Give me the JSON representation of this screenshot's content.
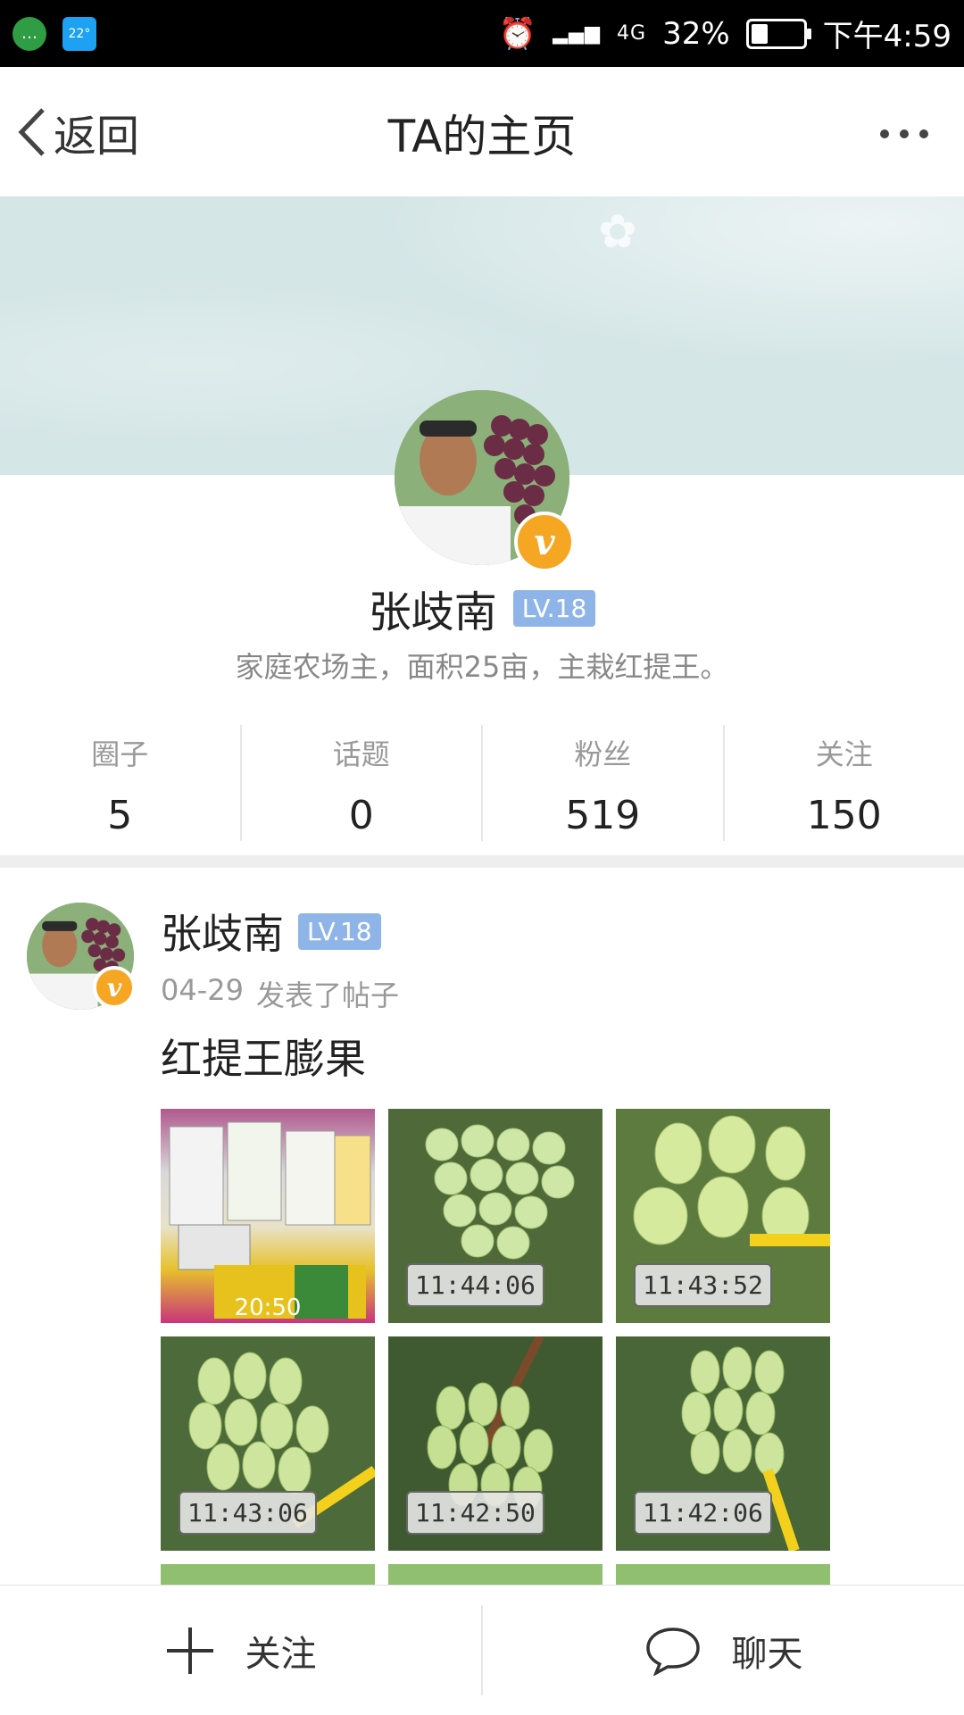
{
  "status_bar": {
    "weather_temp": "22°",
    "network": "4G",
    "battery_percent": "32%",
    "battery_level": 0.32,
    "time": "下午4:59"
  },
  "nav": {
    "back_label": "返回",
    "title": "TA的主页"
  },
  "profile": {
    "name": "张歧南",
    "level": "LV.18",
    "bio": "家庭农场主，面积25亩，主栽红提王。",
    "stats": [
      {
        "label": "圈子",
        "value": "5"
      },
      {
        "label": "话题",
        "value": "0"
      },
      {
        "label": "粉丝",
        "value": "519"
      },
      {
        "label": "关注",
        "value": "150"
      }
    ]
  },
  "post": {
    "author": "张歧南",
    "level": "LV.18",
    "date": "04-29",
    "action": "发表了帖子",
    "title": "红提王膨果",
    "images": [
      {
        "type": "video",
        "duration": "20:50"
      },
      {
        "type": "photo",
        "timestamp": "11:44:06"
      },
      {
        "type": "photo",
        "timestamp": "11:43:52"
      },
      {
        "type": "photo",
        "timestamp": "11:43:06"
      },
      {
        "type": "photo",
        "timestamp": "11:42:50"
      },
      {
        "type": "photo",
        "timestamp": "11:42:06"
      }
    ]
  },
  "bottom_bar": {
    "follow_label": "关注",
    "chat_label": "聊天"
  },
  "colors": {
    "cover_bg": "#d5e6e7",
    "level_badge": "#8fb5e8",
    "verified_badge": "#f5a623"
  }
}
